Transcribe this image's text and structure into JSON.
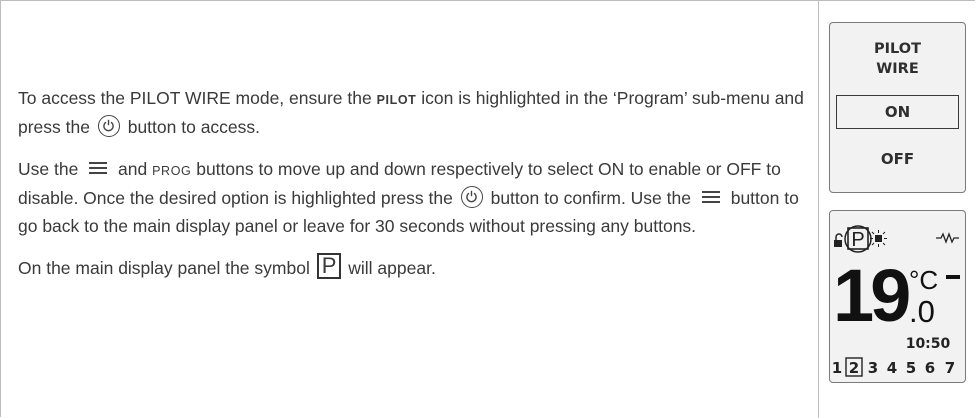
{
  "instructions": {
    "p1": {
      "a": "To access the PILOT WIRE mode, ensure the ",
      "pilot": "PILOT",
      "b": " icon is highlighted in the ‘Program’ sub-menu and press the ",
      "c": " button to access."
    },
    "p2": {
      "a": "Use the ",
      "b": " and ",
      "prog": "PROG",
      "c": " buttons to move up and down respectively to select ON to enable or OFF to disable. Once the desired option is highlighted press the ",
      "d": " button to confirm. Use the ",
      "e": " button to go back to the main display panel or leave for 30 seconds without pressing any buttons."
    },
    "p3": {
      "a": "On the main display panel the symbol ",
      "symbol": "P",
      "b": " will appear."
    }
  },
  "menu_screen": {
    "title_line1": "PILOT",
    "title_line2": "WIRE",
    "on": "ON",
    "off": "OFF",
    "selected": "ON"
  },
  "display_screen": {
    "pilot_symbol": "P",
    "temperature": "19",
    "decimal": ".0",
    "unit": "°C",
    "time": "10:50",
    "days": [
      "1",
      "2",
      "3",
      "4",
      "5",
      "6",
      "7"
    ],
    "current_day": "2",
    "icons": [
      "lock-icon",
      "sun-icon",
      "heating-icon",
      "minus-icon"
    ]
  },
  "colors": {
    "text": "#3a3a3a",
    "border": "#bdbdbd",
    "screen_bg": "#f2f2f2"
  }
}
